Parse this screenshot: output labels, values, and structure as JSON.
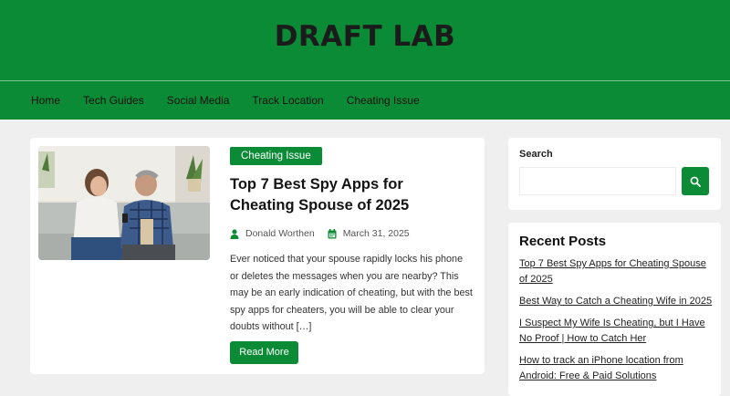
{
  "site": {
    "title": "DRAFT LAB"
  },
  "nav": {
    "items": [
      {
        "label": "Home"
      },
      {
        "label": "Tech Guides"
      },
      {
        "label": "Social Media"
      },
      {
        "label": "Track Location"
      },
      {
        "label": "Cheating Issue"
      }
    ]
  },
  "post": {
    "category": "Cheating Issue",
    "title": "Top 7 Best Spy Apps for Cheating Spouse of 2025",
    "author": "Donald Worthen",
    "author_icon": "user-icon",
    "date": "March 31, 2025",
    "date_icon": "calendar-icon",
    "excerpt": "Ever noticed that your spouse rapidly locks his phone or deletes the messages when you are nearby? This may be an early indication of cheating, but with the best spy apps for cheaters, you will be able to clear your doubts without […]",
    "read_more_label": "Read More",
    "image_alt": "Couple sitting on sofa looking at phone"
  },
  "sidebar": {
    "search": {
      "label": "Search",
      "placeholder": "",
      "value": "",
      "icon": "search-icon"
    },
    "recent": {
      "title": "Recent Posts",
      "items": [
        {
          "label": "Top 7 Best Spy Apps for Cheating Spouse of 2025"
        },
        {
          "label": "Best Way to Catch a Cheating Wife in 2025"
        },
        {
          "label": "I Suspect My Wife Is Cheating, but I Have No Proof | How to Catch Her"
        },
        {
          "label": "How to track an iPhone location from Android: Free & Paid Solutions"
        }
      ]
    }
  },
  "colors": {
    "brand": "#0b8b35",
    "background": "#efefef",
    "card": "#ffffff"
  }
}
